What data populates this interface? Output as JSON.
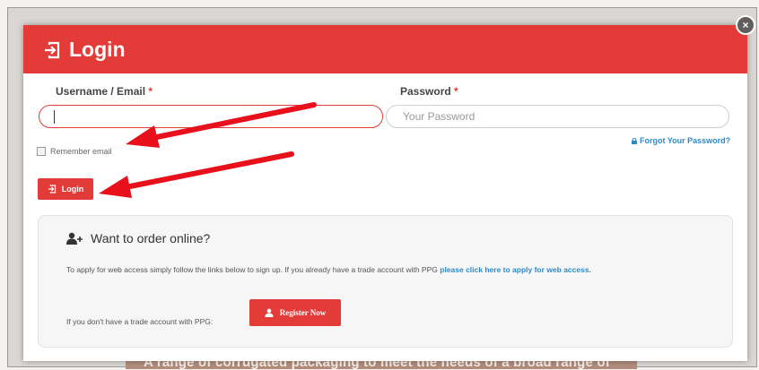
{
  "background": {
    "text": "A range of corrugated packaging to meet the needs of a broad range of"
  },
  "modal": {
    "title": "Login",
    "close_label": "×",
    "username": {
      "label": "Username / Email",
      "required_mark": "*",
      "value": ""
    },
    "password": {
      "label": "Password",
      "required_mark": "*",
      "placeholder": "Your Password"
    },
    "remember_label": "Remember email",
    "forgot_label": "Forgot Your Password?",
    "login_button": "Login"
  },
  "order_online": {
    "title": "Want to order online?",
    "text_before_link": "To apply for web access simply follow the links below to sign up.  If you already have a trade account with PPG ",
    "link_text": "please click here to apply for web access.",
    "no_account_text": "If you don't have a trade account with PPG:",
    "register_button": "Register Now"
  },
  "colors": {
    "accent": "#e33c38",
    "link": "#2b8bc9",
    "annotation_arrow": "#e8101a"
  },
  "icons": [
    "login-icon",
    "close-icon",
    "lock-icon",
    "user-plus-icon",
    "user-icon"
  ]
}
